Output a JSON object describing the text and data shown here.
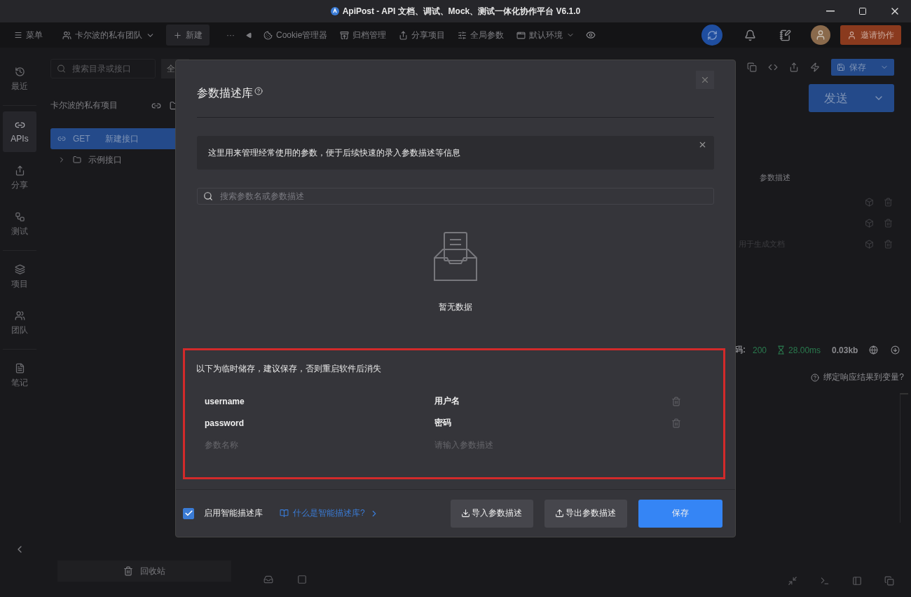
{
  "title_bar": {
    "title": "ApiPost - API 文档、调试、Mock、测试一体化协作平台 V6.1.0"
  },
  "toolbar": {
    "menu": "菜单",
    "team": "卡尔波的私有团队",
    "new_button": "新建",
    "more": "···",
    "tools": [
      {
        "kind": "cookie",
        "label": "Cookie管理器"
      },
      {
        "kind": "archive",
        "label": "归档管理"
      },
      {
        "kind": "share",
        "label": "分享项目"
      },
      {
        "kind": "params",
        "label": "全局参数"
      }
    ],
    "environment": "默认环境",
    "invite_button": "邀请协作"
  },
  "nav": {
    "items": [
      {
        "kind": "recent",
        "label": "最近",
        "selected": false
      },
      {
        "kind": "apis",
        "label": "APIs",
        "selected": true
      },
      {
        "kind": "share",
        "label": "分享",
        "selected": false
      },
      {
        "kind": "test",
        "label": "测试",
        "selected": false
      },
      {
        "kind": "project",
        "label": "项目",
        "selected": false
      },
      {
        "kind": "team",
        "label": "团队",
        "selected": false
      },
      {
        "kind": "note",
        "label": "笔记",
        "selected": false
      }
    ]
  },
  "sidebar": {
    "search": {
      "placeholder": "搜索目录或接口"
    },
    "filter": "全",
    "project": "卡尔波的私有项目",
    "tree": [
      {
        "kind": "api",
        "method": "GET",
        "name": "新建接口",
        "selected": true
      },
      {
        "kind": "folder",
        "name": "示例接口",
        "selected": false
      }
    ],
    "recycle_button": "回收站"
  },
  "main": {
    "save_button": "保存",
    "send_button": "发送",
    "param_header": "参数描述",
    "param_hint": "用于生成文档",
    "status": {
      "label": "码:",
      "code": "200",
      "time": "28.00ms",
      "size": "0.03kb"
    },
    "bind_link": "绑定响应结果到变量?"
  },
  "modal": {
    "title": "参数描述库",
    "notice": "这里用来管理经常使用的参数，便于后续快速的录入参数描述等信息",
    "search": {
      "placeholder": "搜索参数名或参数描述"
    },
    "empty": "暂无数据",
    "temp": {
      "note": "以下为临时储存，建议保存，否则重启软件后消失",
      "rows": [
        {
          "name": "username",
          "description": "用户名"
        },
        {
          "name": "password",
          "description": "密码"
        }
      ],
      "new_row": {
        "name_placeholder": "参数名称",
        "description_placeholder": "请输入参数描述"
      }
    },
    "footer": {
      "smart": {
        "label": "启用智能描述库",
        "checked": true
      },
      "help_link": "什么是智能描述库?",
      "import_button": "导入参数描述",
      "export_button": "导出参数描述",
      "save_button": "保存"
    }
  }
}
